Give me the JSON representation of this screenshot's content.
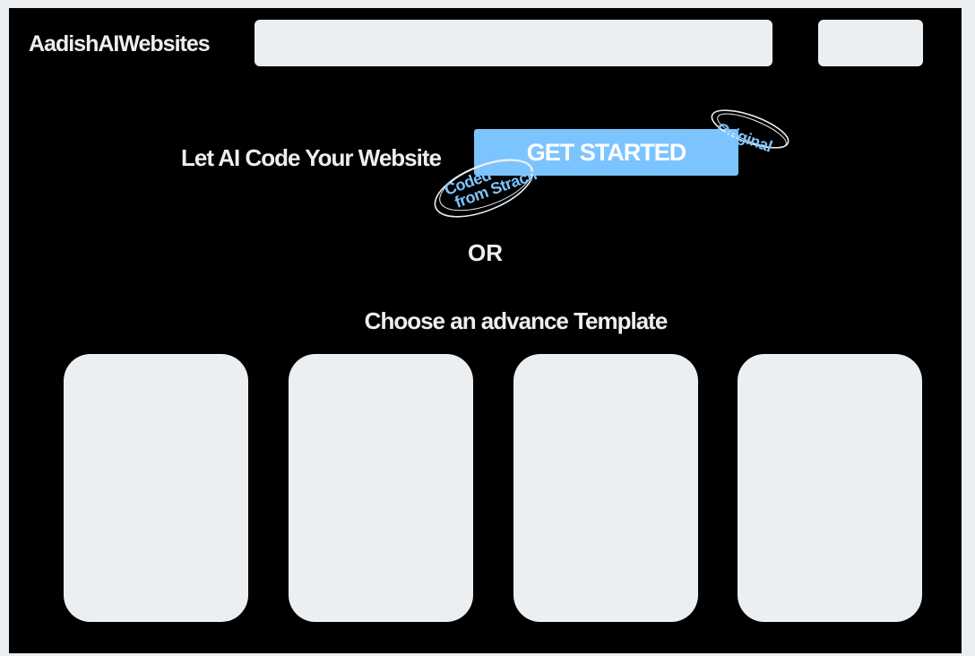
{
  "header": {
    "logo_text": "AadishAIWebsites",
    "search_placeholder": "",
    "button_label": ""
  },
  "hero": {
    "headline": "Let AI Code Your Website",
    "cta_label": "GET STARTED",
    "stamp_original": "Original",
    "stamp_coded_line1": "Coded",
    "stamp_coded_line2": "from Strach"
  },
  "divider_text": "OR",
  "templates": {
    "heading": "Choose an advance Template",
    "cards": [
      "",
      "",
      "",
      ""
    ]
  },
  "colors": {
    "background": "#000000",
    "surface": "#eceff2",
    "accent": "#7cc4ff"
  }
}
